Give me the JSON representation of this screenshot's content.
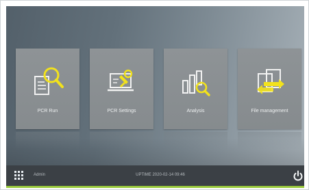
{
  "tiles": [
    {
      "label": "PCR Run",
      "icon": "magnifier-document-icon"
    },
    {
      "label": "PCR Settings",
      "icon": "laptop-settings-icon"
    },
    {
      "label": "Analysis",
      "icon": "bar-chart-magnifier-icon"
    },
    {
      "label": "File management",
      "icon": "file-transfer-icon"
    }
  ],
  "taskbar": {
    "user": "Admin",
    "datetime": "UPTIME 2020-02-14 09:46",
    "apps_icon": "grid-icon",
    "power_icon": "power-icon"
  },
  "colors": {
    "accent": "#f2e21c",
    "taskbar": "#3b4045",
    "status_bar": "#9acb3c"
  }
}
